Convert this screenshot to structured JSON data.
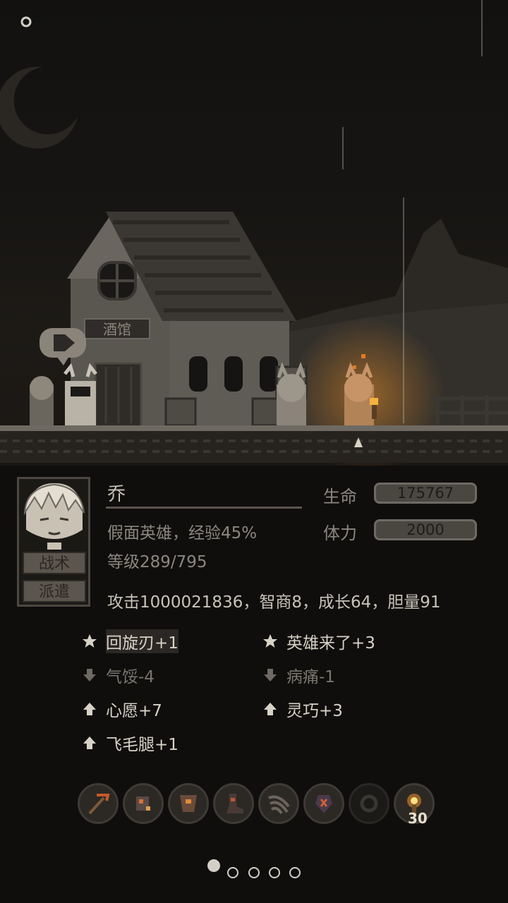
{
  "scene": {
    "sign_text": "酒馆",
    "menu_icon": "menu-ring-icon"
  },
  "hero": {
    "name": "乔",
    "title_exp": "假面英雄，经验45%",
    "level": "等级289/795",
    "hp_label": "生命",
    "hp_value": "175767",
    "stamina_label": "体力",
    "stamina_value": "2000",
    "attributes": "攻击1000021836，智商8，成长64，胆量91",
    "buttons": {
      "tactics": "战术",
      "dispatch": "派遣"
    }
  },
  "traits": [
    {
      "icon": "star-icon",
      "label": "回旋刃+1",
      "kind": "positive"
    },
    {
      "icon": "star-icon",
      "label": "英雄来了+3",
      "kind": "positive"
    },
    {
      "icon": "arrow-down-icon",
      "label": "气馁-4",
      "kind": "negative"
    },
    {
      "icon": "arrow-down-icon",
      "label": "病痛-1",
      "kind": "negative"
    },
    {
      "icon": "arrow-up-icon",
      "label": "心愿+7",
      "kind": "positive"
    },
    {
      "icon": "arrow-up-icon",
      "label": "灵巧+3",
      "kind": "positive"
    },
    {
      "icon": "arrow-up-icon",
      "label": "飞毛腿+1",
      "kind": "positive"
    }
  ],
  "equipment": [
    {
      "icon": "pickaxe-icon"
    },
    {
      "icon": "gauntlet-icon"
    },
    {
      "icon": "armor-icon"
    },
    {
      "icon": "boots-icon"
    },
    {
      "icon": "claw-icon"
    },
    {
      "icon": "rune-icon"
    },
    {
      "icon": "empty-slot-icon"
    },
    {
      "icon": "torch-icon",
      "count": "30"
    }
  ],
  "pagination": {
    "pages": 5,
    "current": 1
  },
  "colors": {
    "accent_fire": "#e08a2a",
    "panel_bg": "#0f0e0d",
    "text": "#c9c3b8"
  }
}
